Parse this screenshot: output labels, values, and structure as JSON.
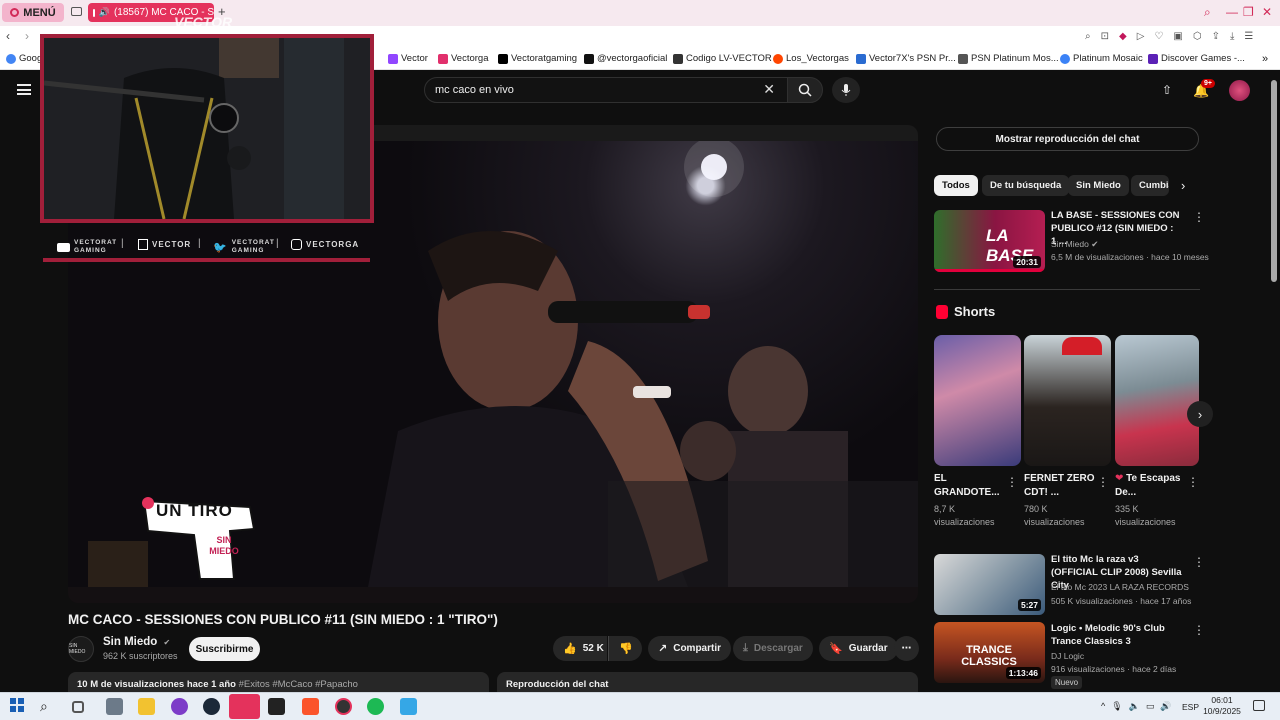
{
  "browser": {
    "menu_label": "MENÚ",
    "active_tab_title": "(18567) MC CACO - S",
    "bookmarks": [
      {
        "label": "Goog",
        "color": "#4285f4"
      },
      {
        "label": "Vector",
        "color": "#9146ff"
      },
      {
        "label": "Vectorga",
        "color": "#e1306c"
      },
      {
        "label": "Vectoratgaming",
        "color": "#000000"
      },
      {
        "label": "@vectorgaoficial",
        "color": "#111111"
      },
      {
        "label": "Codigo LV-VECTOR",
        "color": "#333333"
      },
      {
        "label": "Los_Vectorgas",
        "color": "#ff4500"
      },
      {
        "label": "Vector7X's PSN Pr...",
        "color": "#2a6bd1"
      },
      {
        "label": "PSN Platinum Mos...",
        "color": "#555555"
      },
      {
        "label": "Platinum Mosaic",
        "color": "#3b82f6"
      },
      {
        "label": "Discover Games -...",
        "color": "#5b21b6"
      }
    ]
  },
  "yt": {
    "search_value": "mc caco en vivo",
    "notif_count": "9+",
    "video": {
      "title": "MC CACO - SESSIONES CON PUBLICO #11 (SIN MIEDO : 1 \"TIRO\")",
      "overlay_logo_text_1": "UN TIRO",
      "overlay_logo_text_2": "SIN MIEDO",
      "overlay_brand": "VECTOR",
      "social": [
        {
          "icon": "youtube-icon",
          "label1": "VECTORAT",
          "label2": "GAMING"
        },
        {
          "icon": "twitch-icon",
          "label1": "VECTOR",
          "label2": ""
        },
        {
          "icon": "twitter-icon",
          "label1": "VECTORAT",
          "label2": "GAMING"
        },
        {
          "icon": "instagram-icon",
          "label1": "VECTORGA",
          "label2": ""
        }
      ]
    },
    "channel": {
      "avatar_text": "SIN MIEDO",
      "name": "Sin Miedo",
      "subscribers": "962 K suscriptores",
      "subscribe_label": "Suscribirme"
    },
    "actions": {
      "likes": "52 K",
      "share": "Compartir",
      "download": "Descargar",
      "save": "Guardar"
    },
    "description": {
      "views_date": "10 M de visualizaciones  hace 1 año",
      "tags": "#Exitos #McCaco #Papacho"
    },
    "chat_replay_label": "Reproducción del chat",
    "sidebar": {
      "show_chat": "Mostrar reproducción del chat",
      "chips": [
        "Todos",
        "De tu búsqueda",
        "Sin Miedo",
        "Cumbia"
      ],
      "videos": [
        {
          "title": "LA BASE - SESSIONES CON PUBLICO #12 (SIN MIEDO : 1 ...",
          "channel": "Sin Miedo",
          "meta": "6,5 M de visualizaciones · hace 10 meses",
          "duration": "20:31",
          "thumb_text": "LA BASE"
        },
        {
          "title": "El tito Mc la raza v3 (OFFICIAL CLIP 2008) Sevilla City",
          "channel": "El tito Mc 2023 LA RAZA RECORDS",
          "meta": "505 K visualizaciones · hace 17 años",
          "duration": "5:27",
          "thumb_text": ""
        },
        {
          "title": "Logic • Melodic 90's Club Trance Classics 3",
          "channel": "DJ Logic",
          "meta": "916 visualizaciones · hace 2 días",
          "duration": "1:13:46",
          "thumb_text": "TRANCE CLASSICS",
          "badge": "Nuevo"
        }
      ],
      "shorts_label": "Shorts",
      "shorts": [
        {
          "title": "EL GRANDOTE...",
          "views": "8,7 K visualizaciones"
        },
        {
          "title": "FERNET ZERO CDT! ...",
          "views": "780 K visualizaciones"
        },
        {
          "title": "Te Escapas De...",
          "views": "335 K visualizaciones"
        }
      ]
    }
  },
  "taskbar": {
    "time": "06:01",
    "date": "10/9/2025",
    "lang": "ESP"
  }
}
